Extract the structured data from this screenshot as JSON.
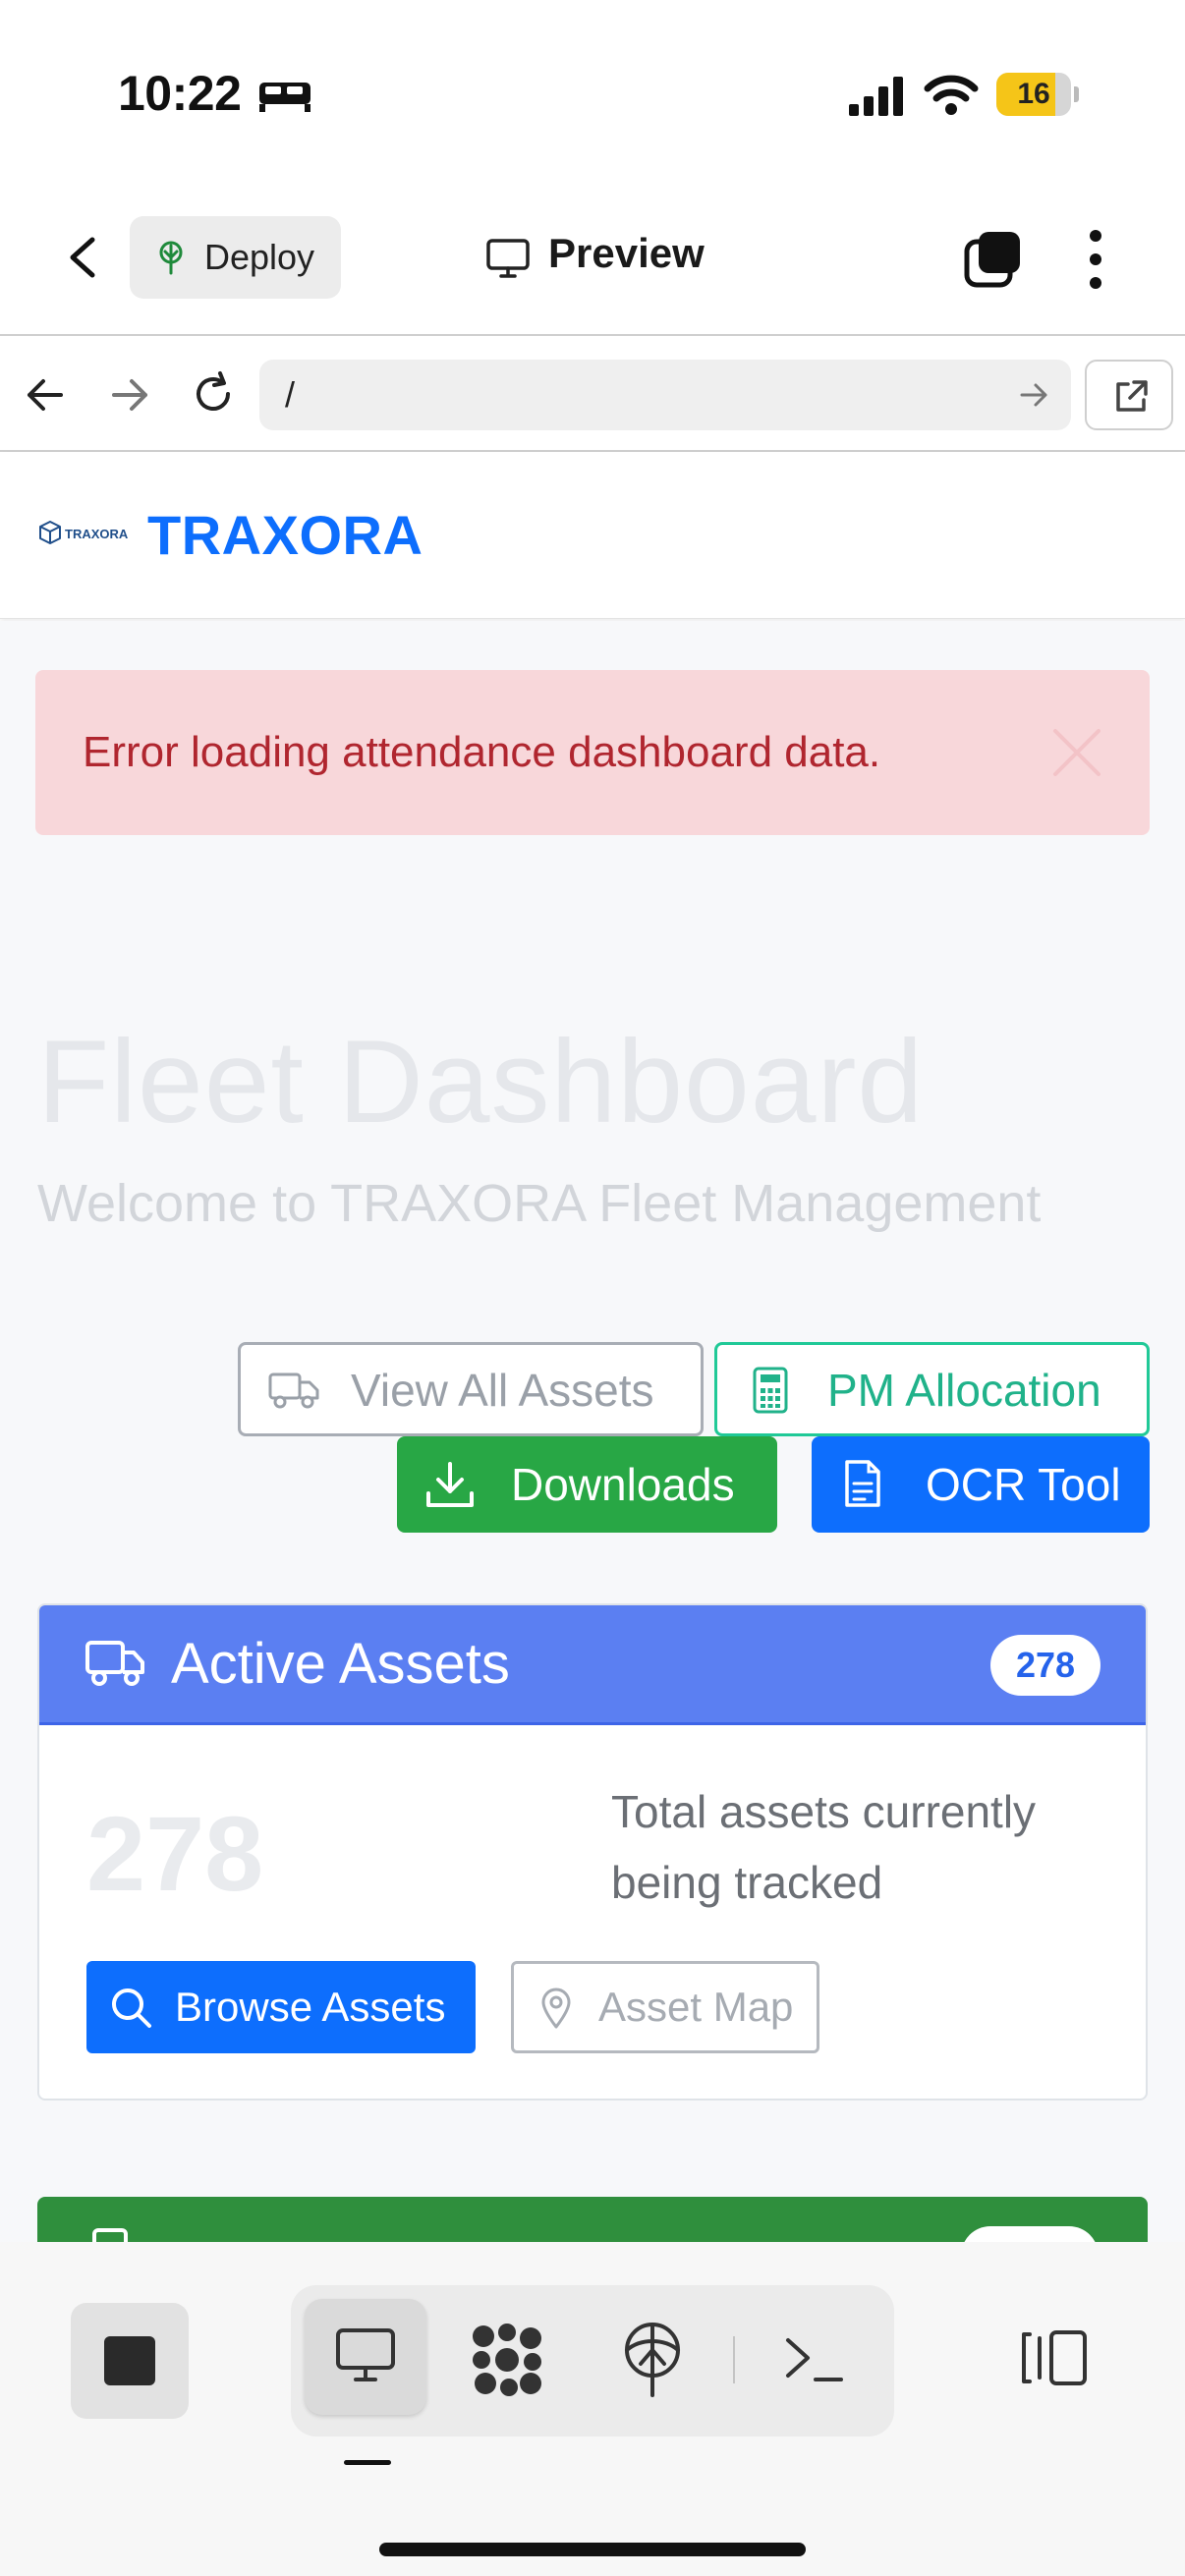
{
  "status_bar": {
    "time": "10:22",
    "battery_level": "16",
    "battery_fraction": 0.16,
    "icons": [
      "bed-icon",
      "signal-icon",
      "wifi-icon",
      "battery-icon"
    ]
  },
  "app_bar": {
    "deploy_label": "Deploy",
    "title": "Preview",
    "icons": [
      "back-chevron-icon",
      "deploy-tree-icon",
      "monitor-icon",
      "tabs-icon",
      "more-vertical-icon"
    ]
  },
  "browser": {
    "url": "/",
    "icons": [
      "arrow-left-icon",
      "arrow-right-icon",
      "reload-icon",
      "go-arrow-icon",
      "open-external-icon"
    ]
  },
  "site": {
    "logo_text": "TRAXORA",
    "brand": "TRAXORA"
  },
  "alert": {
    "message": "Error loading attendance dashboard data."
  },
  "dashboard": {
    "title": "Fleet Dashboard",
    "subtitle": "Welcome to TRAXORA Fleet Management",
    "actions": {
      "view_assets": "View All Assets",
      "pm_allocation": "PM Allocation",
      "downloads": "Downloads",
      "ocr_tool": "OCR Tool"
    }
  },
  "active_assets_card": {
    "title": "Active Assets",
    "badge": "278",
    "count": "278",
    "description": "Total assets currently being tracked",
    "browse_label": "Browse Assets",
    "map_label": "Asset Map"
  },
  "colors": {
    "brand_blue": "#0d6efd",
    "success_green": "#28a745",
    "teal": "#20c997",
    "card_header_blue": "#5b7ff2",
    "alert_bg": "#f8d7da",
    "alert_text": "#b0262f"
  },
  "bottom_toolbar": {
    "icons": [
      "stop-icon",
      "desktop-icon",
      "packages-icon",
      "deploy-icon",
      "shell-icon",
      "panel-toggle-icon"
    ]
  }
}
